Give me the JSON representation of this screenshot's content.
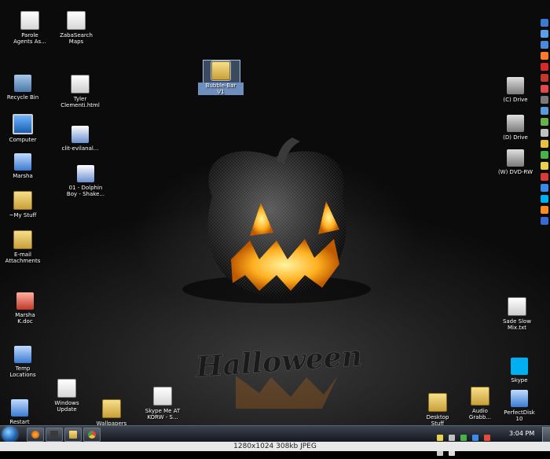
{
  "desktop": {
    "wallpaper_text": "Halloween",
    "icons": [
      {
        "label": "Parole\nAgents As...",
        "icon": "document-icon"
      },
      {
        "label": "ZabaSearch\nMaps",
        "icon": "shortcut-icon"
      },
      {
        "label": "Recycle Bin",
        "icon": "recycle-bin-icon"
      },
      {
        "label": "Tyler\nClementi.html",
        "icon": "html-file-icon"
      },
      {
        "label": "Computer",
        "icon": "computer-icon"
      },
      {
        "label": "clit-evilanal...",
        "icon": "video-file-icon"
      },
      {
        "label": "Marsha",
        "icon": "user-folder-icon"
      },
      {
        "label": "01 - Dolphin\nBoy - Shake...",
        "icon": "video-file-icon"
      },
      {
        "label": "~My Stuff",
        "icon": "folder-icon"
      },
      {
        "label": "E-mail\nAttachments",
        "icon": "folder-icon"
      },
      {
        "label": "Marsha\nK.doc",
        "icon": "doc-file-icon"
      },
      {
        "label": "Temp\nLocations",
        "icon": "folder-icon"
      },
      {
        "label": "Windows\nUpdate",
        "icon": "windows-update-icon"
      },
      {
        "label": "Restart",
        "icon": "restart-icon"
      },
      {
        "label": "Wallpapers",
        "icon": "folder-icon"
      },
      {
        "label": "Skype Me AT\nKORW - S...",
        "icon": "shortcut-icon"
      },
      {
        "label": "Bubble-Bar\nV1",
        "icon": "folder-icon"
      },
      {
        "label": "(C) Drive",
        "icon": "drive-icon"
      },
      {
        "label": "(D) Drive",
        "icon": "drive-icon"
      },
      {
        "label": "(W) DVD-RW",
        "icon": "dvd-drive-icon"
      },
      {
        "label": "Sade Slow\nMix.txt",
        "icon": "text-file-icon"
      },
      {
        "label": "Skype",
        "icon": "skype-icon"
      },
      {
        "label": "Desktop\nStuff",
        "icon": "folder-icon"
      },
      {
        "label": "Audio\nGrabb...",
        "icon": "folder-icon"
      },
      {
        "label": "PerfectDisk\n10",
        "icon": "perfectdisk-icon"
      }
    ]
  },
  "taskbar": {
    "clock": "3:04 PM",
    "pinned": [
      "firefox-icon",
      "media-player-icon",
      "explorer-icon",
      "chrome-icon"
    ]
  },
  "caption": "1280x1024  308kb  JPEG"
}
